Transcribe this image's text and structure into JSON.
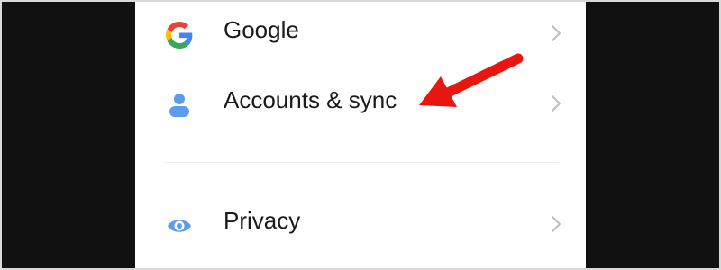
{
  "settings": {
    "items": [
      {
        "label": "Google",
        "icon": "google-g-icon"
      },
      {
        "label": "Accounts & sync",
        "icon": "person-icon"
      },
      {
        "label": "Privacy",
        "icon": "eye-icon"
      }
    ]
  },
  "colors": {
    "accent_blue": "#5b9cf0",
    "annotation_red": "#e8160f",
    "chevron_gray": "#bdbdbd",
    "background": "#111111"
  }
}
